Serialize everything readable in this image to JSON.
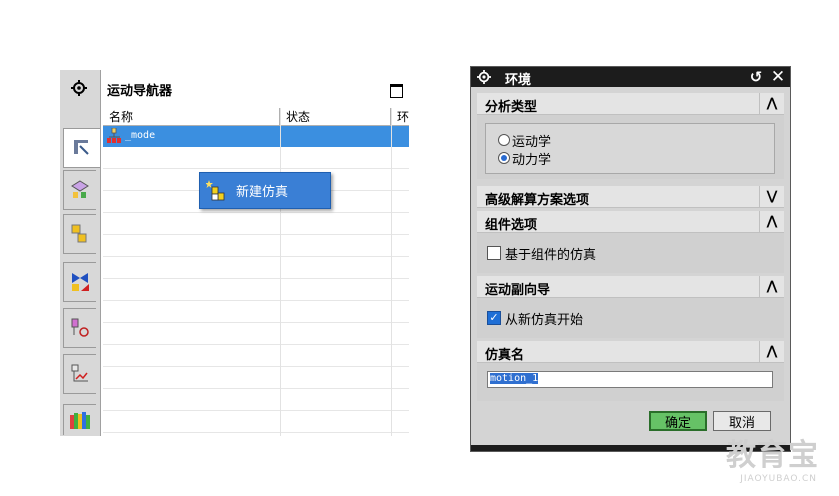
{
  "navigator": {
    "title": "运动导航器",
    "columns": [
      "名称",
      "状态",
      "环"
    ],
    "selected_node": "_mode",
    "context_menu": {
      "item": "新建仿真"
    },
    "tabs": [
      "gear-icon",
      "motion-navigator-icon",
      "assembly-icon",
      "part-icon",
      "constraint-icon",
      "history-icon",
      "graph-icon",
      "library-icon"
    ]
  },
  "dialog": {
    "title": "环境",
    "sections": {
      "analysis_type": {
        "title": "分析类型",
        "options": [
          "运动学",
          "动力学"
        ],
        "selected": "动力学"
      },
      "advanced": {
        "title": "高级解算方案选项"
      },
      "component": {
        "title": "组件选项",
        "checkbox_label": "基于组件的仿真",
        "checked": false
      },
      "wizard": {
        "title": "运动副向导",
        "checkbox_label": "从新仿真开始",
        "checked": true
      },
      "sim_name": {
        "title": "仿真名",
        "value": "motion_1"
      }
    },
    "ok_label": "确定",
    "cancel_label": "取消"
  },
  "watermark": {
    "main": "教育宝",
    "sub": "JIAOYUBAO.CN"
  }
}
